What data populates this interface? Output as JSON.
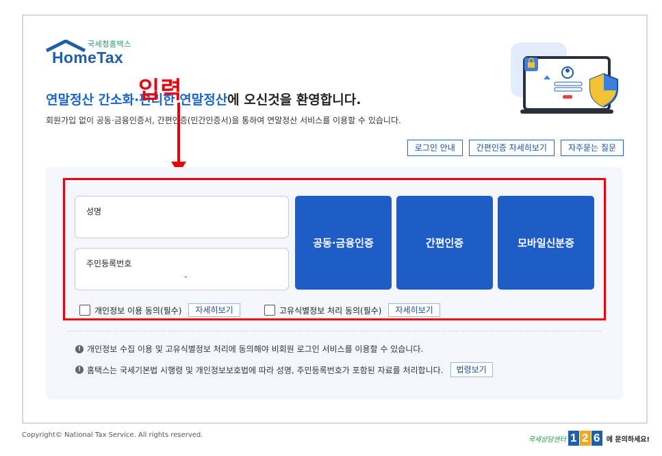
{
  "logo": {
    "small": "국세청홈택스",
    "main": "HomeTax"
  },
  "welcome": {
    "highlight": "연말정산 간소화·편리한 연말정산",
    "rest": "에 오신것을 환영합니다."
  },
  "subtitle": "회원가입 없이 공동·금융인증서, 간편인증(민간인증서)을 통하여 연말정산 서비스를 이용할 수 있습니다.",
  "annotation": {
    "text": "입력",
    "color": "#e8000b"
  },
  "top_buttons": [
    "로그인 안내",
    "간편인증 자세히보기",
    "자주묻는 질문"
  ],
  "form": {
    "name_label": "성명",
    "rrn_label": "주민등록번호",
    "rrn_separator": "-"
  },
  "auth_buttons": [
    "공동·금융인증",
    "간편인증",
    "모바일신분증"
  ],
  "consents": [
    {
      "label": "개인정보 이용 동의(필수)",
      "detail": "자세히보기"
    },
    {
      "label": "고유식별정보 처리 동의(필수)",
      "detail": "자세히보기"
    }
  ],
  "notices": [
    "개인정보 수집 이용 및 고유식별정보 처리에 동의해야 비회원 로그인 서비스를 이용할 수 있습니다.",
    "홈택스는 국세기본법 시행령 및 개인정보보호법에 따라 성명, 주민등록번호가 포함된 자료를 처리합니다."
  ],
  "law_button": "법령보기",
  "footer": {
    "copyright": "Copyright© National Tax Service. All rights reserved.",
    "callcenter_label": "국세상담센터",
    "callcenter_digits": [
      "1",
      "2",
      "6"
    ],
    "callcenter_text": "에 문의하세요!"
  },
  "colors": {
    "primary": "#1f5dc6",
    "accent_text": "#1b64c8",
    "annotation_red": "#e8000b",
    "panel_bg": "#f3f6fb"
  }
}
